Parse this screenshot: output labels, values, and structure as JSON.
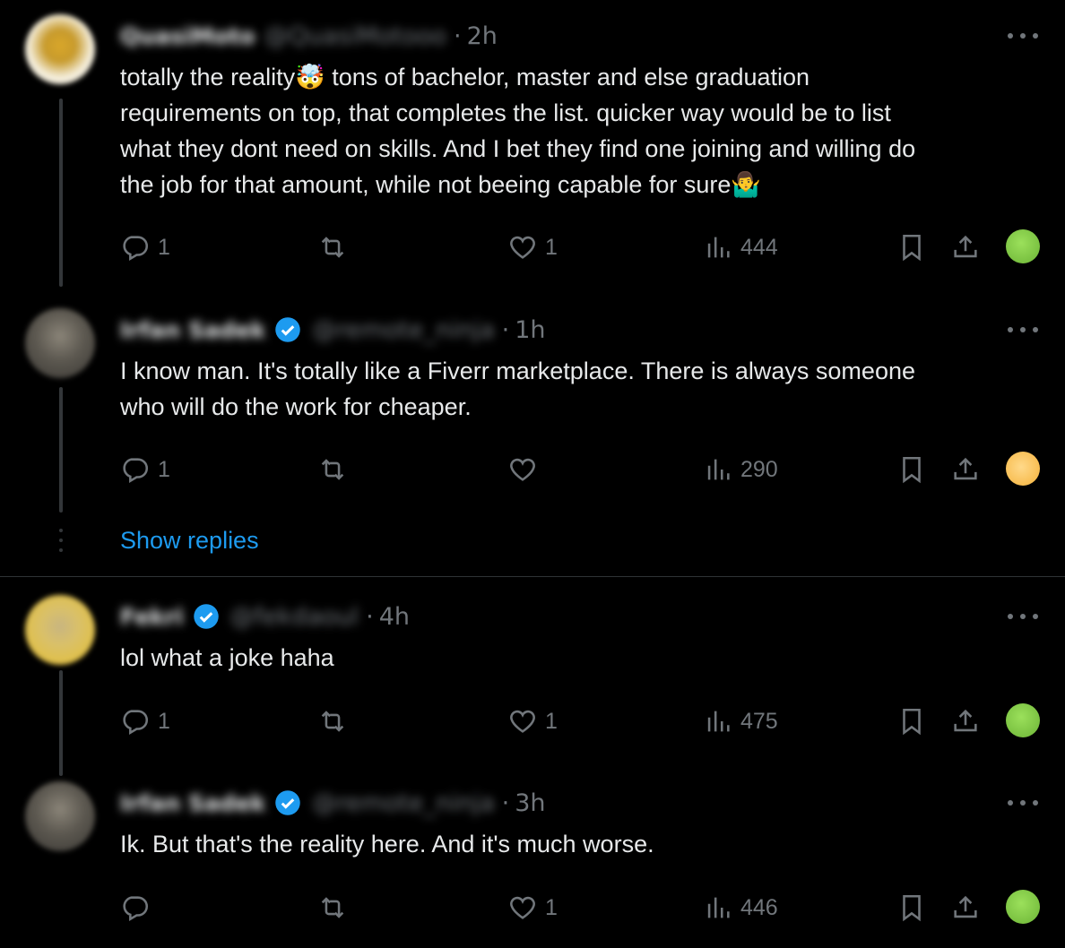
{
  "colors": {
    "background": "#000000",
    "text": "#e7e9ea",
    "muted": "#71767b",
    "accent": "#1d9bf0",
    "verified": "#1d9bf0"
  },
  "tweets": [
    {
      "time": "2h",
      "text": "totally the reality🤯 tons of bachelor, master and else graduation\nrequirements on top, that completes the list. quicker way would be to list\nwhat they dont need on skills. And I bet they find one joining and willing do\nthe job for that amount, while not beeing capable for sure🤷‍♂️",
      "name": "QuasiMoto",
      "handle": "@QuasiMotooo",
      "verified": false,
      "replies": "1",
      "reposts": "",
      "likes": "1",
      "views": "444",
      "reaction_icon": "nauseated-face-icon"
    },
    {
      "time": "1h",
      "text": "I know man. It's totally like a Fiverr marketplace. There is always someone\nwho will do the work for cheaper.",
      "name": "Irfan Sadek",
      "handle": "@remote_ninja",
      "verified": true,
      "replies": "1",
      "reposts": "",
      "likes": "",
      "views": "290",
      "reaction_icon": "partying-face-icon"
    },
    {
      "time": "4h",
      "text": "lol what a joke haha",
      "name": "Fekri",
      "handle": "@fekdaoul",
      "verified": true,
      "replies": "1",
      "reposts": "",
      "likes": "1",
      "views": "475",
      "reaction_icon": "nauseated-face-icon"
    },
    {
      "time": "3h",
      "text": "Ik. But that's the reality here. And it's much worse.",
      "name": "Irfan Sadek",
      "handle": "@remote_ninja",
      "verified": true,
      "replies": "",
      "reposts": "",
      "likes": "1",
      "views": "446",
      "reaction_icon": "nauseated-face-icon"
    }
  ],
  "show_replies_label": "Show replies"
}
